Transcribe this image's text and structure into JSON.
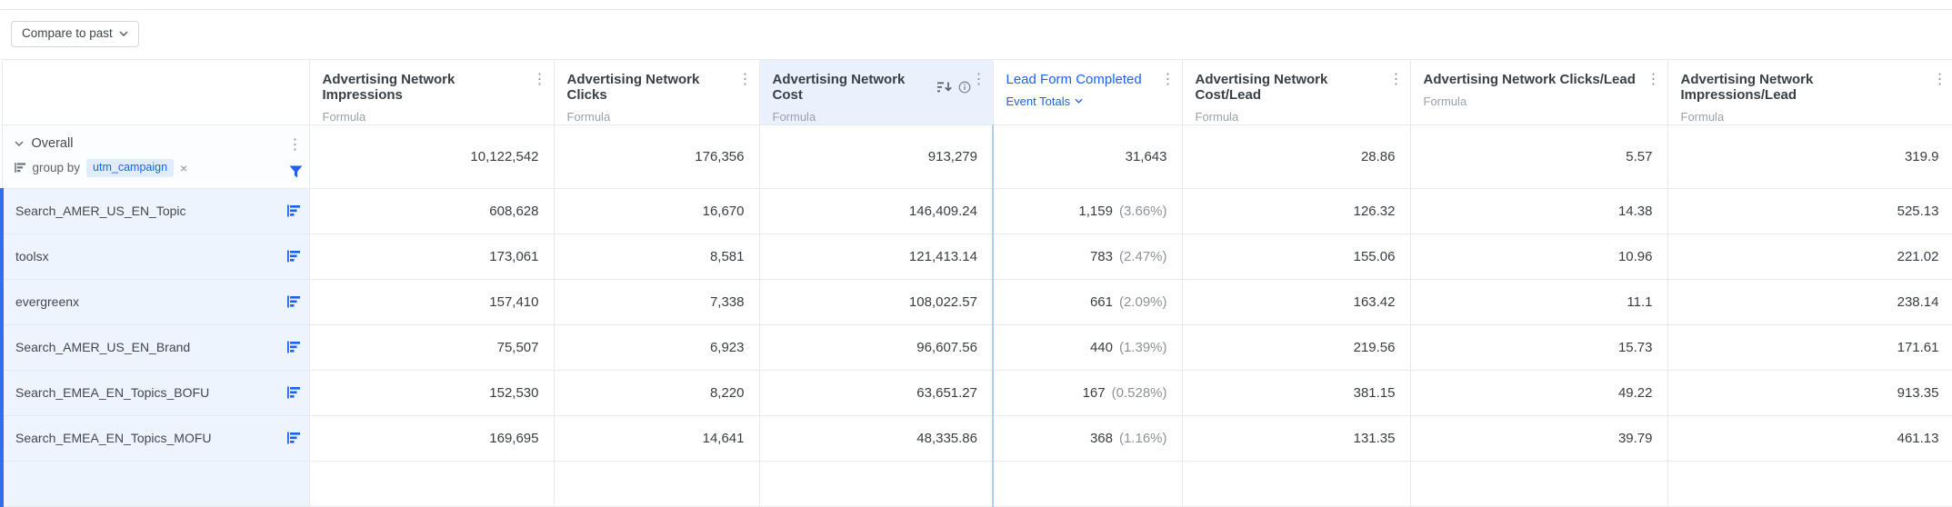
{
  "toolbar": {
    "compare_button_label": "Compare to past"
  },
  "colors": {
    "accent_blue": "#1e61f0",
    "column_highlight_bg": "#e9f1fd",
    "row_label_bg": "#edf4fd",
    "row_label_stripe": "#2f6fed",
    "border_gray": "#e7e9ec"
  },
  "icons": {
    "kebab": "⋮",
    "remove_x": "×",
    "chevron_down": "⌄",
    "sort_descending": "bars-with-down-arrow",
    "info": "circled-i",
    "filter": "blue-funnel",
    "bar_chart": "blue-horizontal-bars",
    "group_by": "gray-horizontal-bars"
  },
  "table": {
    "columns": [
      {
        "title": "Advertising Network Impressions",
        "subtitle": "Formula"
      },
      {
        "title": "Advertising Network Clicks",
        "subtitle": "Formula"
      },
      {
        "title": "Advertising Network Cost",
        "subtitle": "Formula",
        "highlighted": true,
        "sorted": true,
        "has_info": true
      },
      {
        "title": "Lead Form Completed",
        "subtitle": "Event Totals",
        "type": "event"
      },
      {
        "title": "Advertising Network Cost/Lead",
        "subtitle": "Formula"
      },
      {
        "title": "Advertising Network Clicks/Lead",
        "subtitle": "Formula"
      },
      {
        "title": "Advertising Network Impressions/Lead",
        "subtitle": "Formula"
      }
    ],
    "overall_row": {
      "label": "Overall",
      "group_by": {
        "prefix": "group by",
        "field": "utm_campaign"
      },
      "values": [
        "10,122,542",
        "176,356",
        "913,279",
        "31,643",
        "28.86",
        "5.57",
        "319.9"
      ]
    },
    "rows": [
      {
        "label": "Search_AMER_US_EN_Topic",
        "impressions": "608,628",
        "clicks": "16,670",
        "cost": "146,409.24",
        "leads": "1,159",
        "leads_pct": "(3.66%)",
        "cost_per_lead": "126.32",
        "clicks_per_lead": "14.38",
        "impressions_per_lead": "525.13"
      },
      {
        "label": "toolsx",
        "impressions": "173,061",
        "clicks": "8,581",
        "cost": "121,413.14",
        "leads": "783",
        "leads_pct": "(2.47%)",
        "cost_per_lead": "155.06",
        "clicks_per_lead": "10.96",
        "impressions_per_lead": "221.02"
      },
      {
        "label": "evergreenx",
        "impressions": "157,410",
        "clicks": "7,338",
        "cost": "108,022.57",
        "leads": "661",
        "leads_pct": "(2.09%)",
        "cost_per_lead": "163.42",
        "clicks_per_lead": "11.1",
        "impressions_per_lead": "238.14"
      },
      {
        "label": "Search_AMER_US_EN_Brand",
        "impressions": "75,507",
        "clicks": "6,923",
        "cost": "96,607.56",
        "leads": "440",
        "leads_pct": "(1.39%)",
        "cost_per_lead": "219.56",
        "clicks_per_lead": "15.73",
        "impressions_per_lead": "171.61"
      },
      {
        "label": "Search_EMEA_EN_Topics_BOFU",
        "impressions": "152,530",
        "clicks": "8,220",
        "cost": "63,651.27",
        "leads": "167",
        "leads_pct": "(0.528%)",
        "cost_per_lead": "381.15",
        "clicks_per_lead": "49.22",
        "impressions_per_lead": "913.35"
      },
      {
        "label": "Search_EMEA_EN_Topics_MOFU",
        "impressions": "169,695",
        "clicks": "14,641",
        "cost": "48,335.86",
        "leads": "368",
        "leads_pct": "(1.16%)",
        "cost_per_lead": "131.35",
        "clicks_per_lead": "39.79",
        "impressions_per_lead": "461.13"
      }
    ]
  }
}
